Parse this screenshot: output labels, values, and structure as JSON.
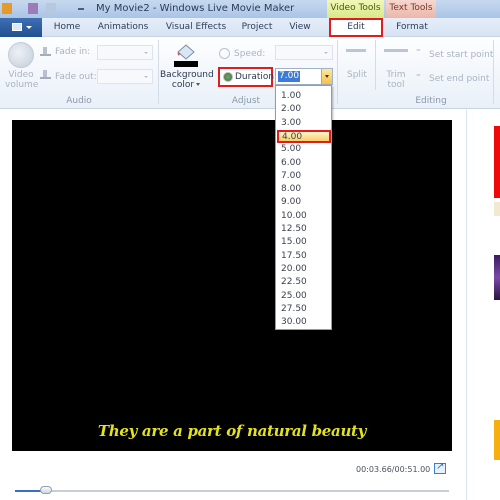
{
  "window": {
    "title": "My Movie2 - Windows Live Movie Maker",
    "context_tabs": {
      "video_tools": "Video Tools",
      "text_tools": "Text Tools"
    }
  },
  "tabs": [
    {
      "label": "Home"
    },
    {
      "label": "Animations"
    },
    {
      "label": "Visual Effects"
    },
    {
      "label": "Project"
    },
    {
      "label": "View"
    },
    {
      "label": "Edit",
      "active": true
    },
    {
      "label": "Format"
    }
  ],
  "ribbon": {
    "audio": {
      "label": "Audio",
      "video_volume": "Video volume",
      "fade_in": "Fade in:",
      "fade_out": "Fade out:"
    },
    "adjust": {
      "label": "Adjust",
      "background_color_line1": "Background",
      "background_color_line2": "color",
      "background_color_value": "#000000",
      "speed": "Speed:",
      "duration": "Duration:",
      "duration_value": "7.00"
    },
    "editing": {
      "label": "Editing",
      "split": "Split",
      "trim_line1": "Trim",
      "trim_line2": "tool",
      "set_start": "Set start point",
      "set_end": "Set end point"
    }
  },
  "duration_dropdown": {
    "options": [
      "1.00",
      "2.00",
      "3.00",
      "4.00",
      "5.00",
      "6.00",
      "7.00",
      "8.00",
      "9.00",
      "10.00",
      "12.50",
      "15.00",
      "17.50",
      "20.00",
      "22.50",
      "25.00",
      "27.50",
      "30.00"
    ],
    "highlighted": "4.00"
  },
  "preview": {
    "caption": "They are a part of natural beauty",
    "time": "00:03.66/00:51.00",
    "progress_fraction": 0.072
  },
  "colors": {
    "highlight_border": "#e01c1c",
    "caption_color": "#e2e21e",
    "accent": "#3a6fc6"
  }
}
